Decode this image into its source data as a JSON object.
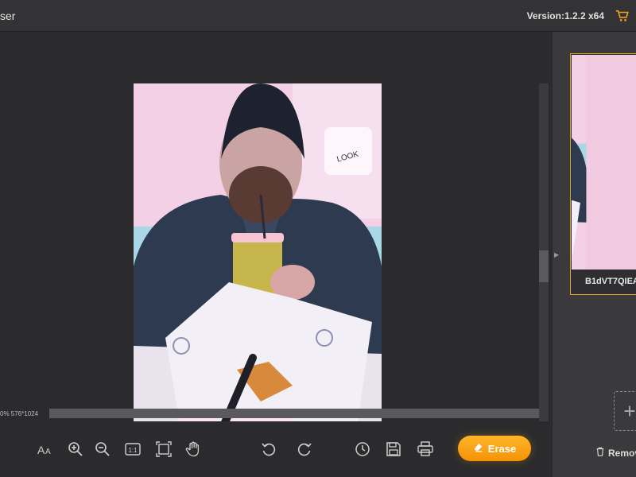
{
  "header": {
    "title": "ser",
    "version": "Version:1.2.2 x64",
    "cart_icon": "cart-icon"
  },
  "status": {
    "text": "0%  576*1024"
  },
  "toolbar": {
    "tools": [
      {
        "name": "text-size-icon"
      },
      {
        "name": "zoom-in-icon"
      },
      {
        "name": "zoom-out-icon"
      },
      {
        "name": "actual-size-icon",
        "label": "1:1"
      },
      {
        "name": "fit-screen-icon"
      },
      {
        "name": "hand-pan-icon"
      },
      {
        "name": "undo-icon"
      },
      {
        "name": "redo-icon"
      },
      {
        "name": "history-icon"
      },
      {
        "name": "save-icon"
      },
      {
        "name": "print-icon"
      }
    ],
    "erase_label": "Erase"
  },
  "right_panel": {
    "thumbnail_label": "B1dVT7QIEA",
    "add_symbol": "+",
    "remove_label": "Remov"
  },
  "colors": {
    "accent": "#f49306",
    "thumb_border": "#e3a120",
    "background": "#2b2b2d"
  }
}
